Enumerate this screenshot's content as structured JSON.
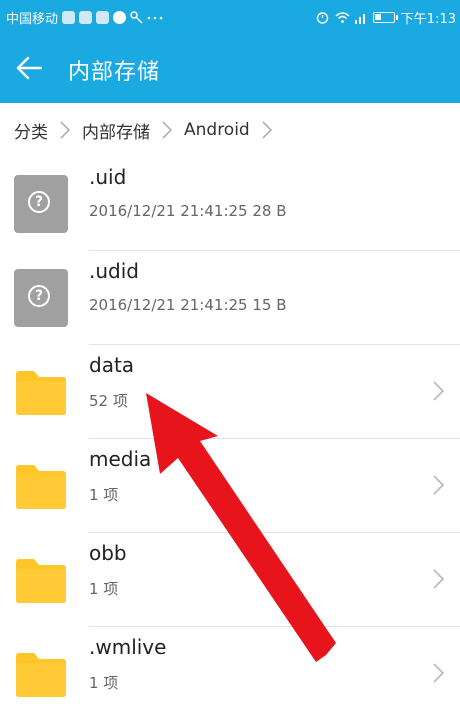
{
  "statusbar": {
    "carrier": "中国移动",
    "time": "下午1:13"
  },
  "toolbar": {
    "title": "内部存储"
  },
  "breadcrumb": [
    "分类",
    "内部存储",
    "Android"
  ],
  "files": [
    {
      "name": ".uid",
      "meta": "2016/12/21 21:41:25 28 B",
      "type": "unknown"
    },
    {
      "name": ".udid",
      "meta": "2016/12/21 21:41:25 15 B",
      "type": "unknown"
    },
    {
      "name": "data",
      "meta": "52 项",
      "type": "folder"
    },
    {
      "name": "media",
      "meta": "1 项",
      "type": "folder"
    },
    {
      "name": "obb",
      "meta": "1 项",
      "type": "folder"
    },
    {
      "name": ".wmlive",
      "meta": "1 项",
      "type": "folder"
    }
  ],
  "colors": {
    "header": "#1ba9e1",
    "folder": "#ffc62a",
    "annotation_arrow": "#e8141b"
  },
  "icons": {
    "back": "arrow-left-icon",
    "breadcrumb_separator": "chevron-right-icon",
    "unknown_file": "question-file-icon",
    "folder": "folder-icon",
    "row_chevron": "chevron-right-icon"
  }
}
